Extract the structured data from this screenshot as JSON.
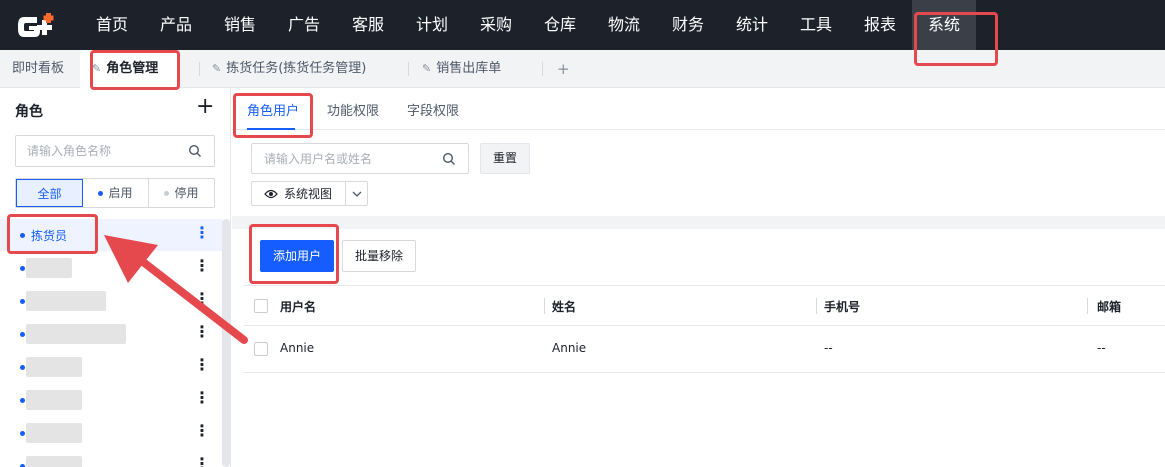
{
  "colors": {
    "brand_blue": "#165dff",
    "topbar_bg": "#1d2129",
    "highlight_red": "#e5484d",
    "logo_orange": "#ff6a2f"
  },
  "topnav": {
    "logo_icon": "logo-icon",
    "items": [
      {
        "label": "首页"
      },
      {
        "label": "产品"
      },
      {
        "label": "销售"
      },
      {
        "label": "广告"
      },
      {
        "label": "客服"
      },
      {
        "label": "计划"
      },
      {
        "label": "采购"
      },
      {
        "label": "仓库"
      },
      {
        "label": "物流"
      },
      {
        "label": "财务"
      },
      {
        "label": "统计"
      },
      {
        "label": "工具"
      },
      {
        "label": "报表"
      },
      {
        "label": "系统",
        "active": true
      }
    ]
  },
  "tabs": {
    "items": [
      {
        "label": "即时看板",
        "pinned": false,
        "active": false
      },
      {
        "label": "角色管理",
        "pinned": true,
        "active": true
      },
      {
        "label": "拣货任务(拣货任务管理)",
        "pinned": true,
        "active": false
      },
      {
        "label": "销售出库单",
        "pinned": true,
        "active": false
      }
    ],
    "pin_icon": "pin-icon",
    "add_label": "+"
  },
  "sidebar": {
    "title": "角色",
    "add_label": "+",
    "search_placeholder": "请输入角色名称",
    "filters": [
      {
        "label": "全部",
        "active": true
      },
      {
        "label": "启用",
        "dot_color": "#165dff"
      },
      {
        "label": "停用",
        "dot_color": "#c9cdd4"
      }
    ],
    "roles": [
      {
        "label": "拣货员",
        "selected": true,
        "more": "⋮"
      },
      {
        "label": "",
        "blurred": true,
        "more": "⋮"
      },
      {
        "label": "",
        "blurred": true,
        "more": "⋮"
      },
      {
        "label": "",
        "blurred": true,
        "more": "⋮"
      },
      {
        "label": "",
        "blurred": true,
        "more": "⋮"
      },
      {
        "label": "",
        "blurred": true,
        "more": "⋮"
      },
      {
        "label": "",
        "blurred": true,
        "more": "⋮"
      },
      {
        "label": "",
        "blurred": true,
        "more": "⋮"
      }
    ]
  },
  "main": {
    "subtabs": [
      {
        "label": "角色用户",
        "active": true
      },
      {
        "label": "功能权限"
      },
      {
        "label": "字段权限"
      }
    ],
    "user_search_placeholder": "请输入用户名或姓名",
    "reset_label": "重置",
    "view_label": "系统视图",
    "add_user_label": "添加用户",
    "batch_remove_label": "批量移除",
    "columns": [
      "用户名",
      "姓名",
      "手机号",
      "邮箱"
    ],
    "rows": [
      {
        "username": "Annie",
        "name": "Annie",
        "phone": "--",
        "email": "--"
      }
    ]
  }
}
